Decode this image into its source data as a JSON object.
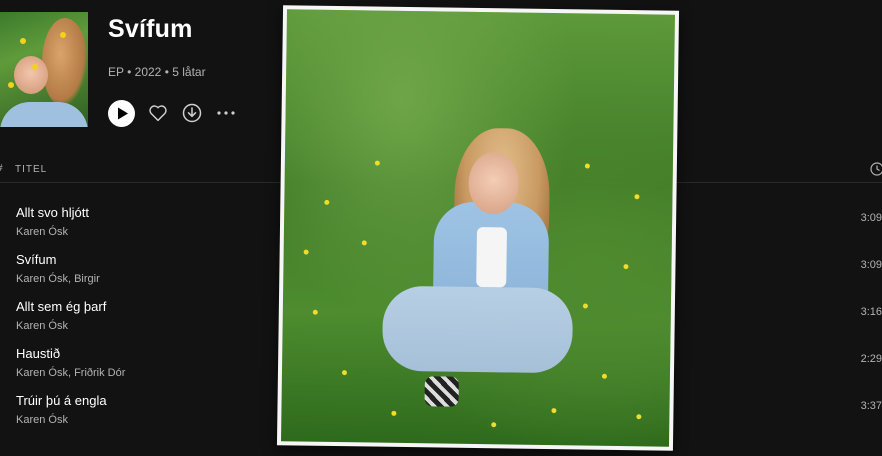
{
  "album": {
    "title": "Svífum",
    "meta": "EP • 2022 • 5 låtar"
  },
  "controls": {
    "play": "play-icon",
    "like": "heart-icon",
    "download": "download-icon",
    "more": "more-icon"
  },
  "columns": {
    "hash": "#",
    "title": "TITEL",
    "duration_icon": "clock-icon"
  },
  "tracks": [
    {
      "name": "Allt svo hljótt",
      "artist": "Karen Ósk",
      "duration": "3:09"
    },
    {
      "name": "Svífum",
      "artist": "Karen Ósk, Birgir",
      "duration": "3:09"
    },
    {
      "name": "Allt sem ég þarf",
      "artist": "Karen Ósk",
      "duration": "3:16"
    },
    {
      "name": "Haustið",
      "artist": "Karen Ósk, Friðrik Dór",
      "duration": "2:29"
    },
    {
      "name": "Trúir þú á engla",
      "artist": "Karen Ósk",
      "duration": "3:37"
    }
  ],
  "colors": {
    "background": "#121212",
    "text_primary": "#ffffff",
    "text_secondary": "#b3b3b3"
  }
}
